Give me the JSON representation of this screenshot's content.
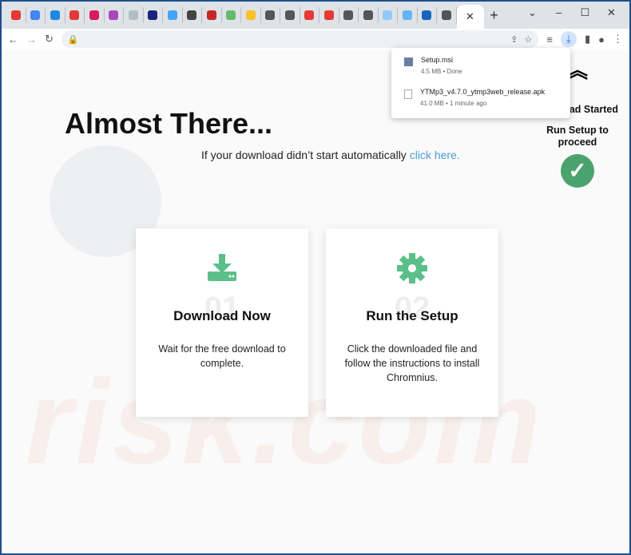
{
  "browser": {
    "tab_favicons": [
      "#e53935",
      "#4285f4",
      "#1e88e5",
      "#e53935",
      "#d81b60",
      "#ab47bc",
      "#b0bec5",
      "#1a237e",
      "#42a5f5",
      "#444",
      "#c62828",
      "#66bb6a",
      "#fbc02d",
      "#555",
      "#555",
      "#e53935",
      "#e53935",
      "#555",
      "#555",
      "#90caf9",
      "#64b5f6",
      "#1565c0",
      "#555"
    ],
    "active_tab_close": "✕",
    "new_tab": "+",
    "window_controls": [
      "⌄",
      "–",
      "☐",
      "✕"
    ]
  },
  "downloads": [
    {
      "name": "Setup.msi",
      "status": "4.5 MB • Done"
    },
    {
      "name": "YTMp3_v4.7.0_ytmp3web_release.apk",
      "status": "41.0 MB • 1 minute ago"
    }
  ],
  "page": {
    "title": "Almost There...",
    "subtitle": "If your download didn’t start automatically ",
    "link": "click here.",
    "side_status": "ad Started",
    "side_instruction": "Run Setup to proceed",
    "watermark": "risk.com",
    "cards": [
      {
        "num": "01",
        "title": "Download Now",
        "desc": "Wait for the free download to complete.",
        "icon": "download-drive-icon"
      },
      {
        "num": "02",
        "title": "Run the Setup",
        "desc": "Click the downloaded file and follow the instructions to install Chromnius.",
        "icon": "gear-icon"
      }
    ]
  },
  "colors": {
    "accent": "#5cbf8a",
    "link": "#4a9bd6",
    "check": "#4aa36c"
  }
}
